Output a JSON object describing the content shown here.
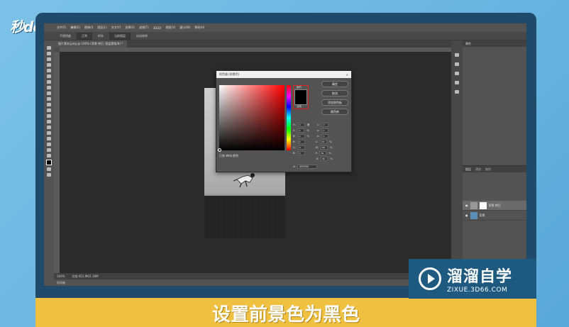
{
  "logo_text": "秒dong视频",
  "menu": [
    "文件(F)",
    "编辑(E)",
    "图像(I)",
    "图层(L)",
    "文字(Y)",
    "选择(S)",
    "滤镜(T)",
    "3D(D)",
    "视图(V)",
    "窗口(W)",
    "帮助(H)"
  ],
  "options": {
    "opacity": "不透明度",
    "mode": "正常",
    "sample": "样本",
    "sample_val": "当前图层",
    "check": "自动抹除"
  },
  "tab_label": "图片素材.jpeg @ 100% (背景 拷贝, 图层蒙版/8) *",
  "status": {
    "zoom": "100%",
    "doc": "文档:451.9K/1.36M"
  },
  "timeline_label": "时间轴",
  "picker": {
    "title": "拾色器 (前景色)",
    "close": "×",
    "new_label": "新的",
    "current_label": "当前",
    "buttons": [
      "确定",
      "取消",
      "添加到色板",
      "颜色库"
    ],
    "hsb": [
      [
        "H:",
        "0",
        "度"
      ],
      [
        "S:",
        "0",
        "%"
      ],
      [
        "B:",
        "0",
        "%"
      ]
    ],
    "rgb": [
      [
        "R:",
        "0",
        ""
      ],
      [
        "G:",
        "0",
        ""
      ],
      [
        "B:",
        "0",
        ""
      ]
    ],
    "lab": [
      [
        "L:",
        "0",
        ""
      ],
      [
        "a:",
        "0",
        ""
      ],
      [
        "b:",
        "0",
        ""
      ]
    ],
    "cmyk": [
      [
        "C:",
        "93",
        "%"
      ],
      [
        "M:",
        "88",
        "%"
      ],
      [
        "Y:",
        "89",
        "%"
      ],
      [
        "K:",
        "80",
        "%"
      ]
    ],
    "web_only": "只有 Web 颜色",
    "hex_label": "#",
    "hex_value": "000000"
  },
  "panels": {
    "props": "属性",
    "layers_tab": "图层",
    "channels_tab": "通道",
    "paths_tab": "路径"
  },
  "layers": [
    {
      "name": "背景 拷贝",
      "active": true
    },
    {
      "name": "背景",
      "active": false
    }
  ],
  "caption": "设置前景色为黑色",
  "brand": {
    "name": "溜溜自学",
    "url": "ZIXUE.3D66.COM"
  }
}
